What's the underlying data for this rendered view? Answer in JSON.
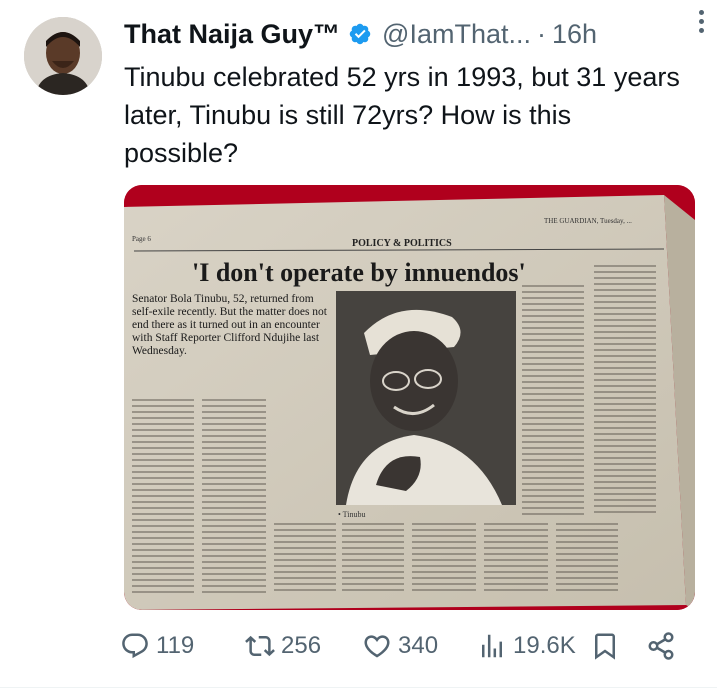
{
  "tweet": {
    "author_name": "That Naija Guy™",
    "handle": "@IamThat...",
    "separator": "·",
    "time": "16h",
    "text": "Tinubu celebrated 52 yrs in 1993, but 31 years later, Tinubu is still 72yrs? How is this possible?"
  },
  "newspaper": {
    "masthead": "THE GUARDIAN, Tuesday, ...",
    "page": "Page 6",
    "section": "POLICY & POLITICS",
    "headline": "'I don't operate by innuendos'",
    "lead": "Senator Bola Tinubu, 52, returned from self-exile recently. But the matter does not end there as it turned out in an encounter with Staff Reporter Clifford Ndujihe last Wednesday.",
    "caption": "• Tinubu"
  },
  "actions": {
    "reply_count": "119",
    "repost_count": "256",
    "like_count": "340",
    "view_count": "19.6K"
  },
  "icons": {
    "verified": "verified-badge-icon",
    "more": "more-dots-icon",
    "reply": "reply-icon",
    "repost": "repost-icon",
    "like": "like-icon",
    "views": "views-icon",
    "bookmark": "bookmark-icon",
    "share": "share-icon"
  },
  "colors": {
    "verified": "#1d9bf0",
    "muted": "#536471",
    "border": "#b0001d"
  }
}
